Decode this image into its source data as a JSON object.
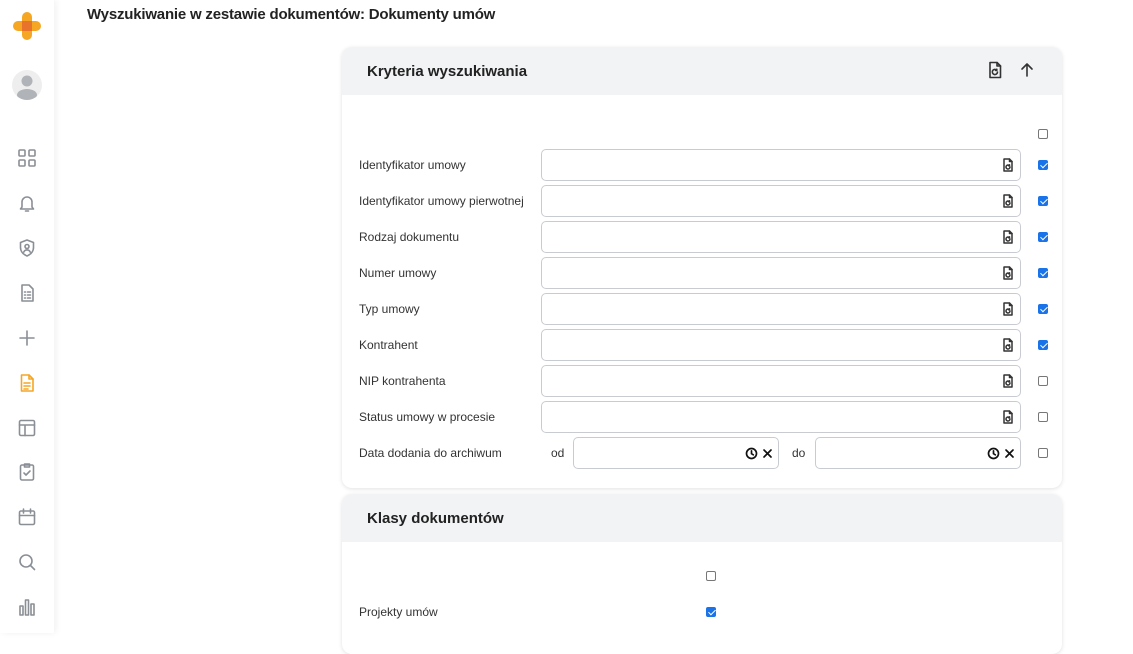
{
  "app": {
    "logo_icon": "plus-logo-icon",
    "accent_color": "#f5a623"
  },
  "sidebar": {
    "items": [
      {
        "name": "dashboard-icon",
        "active": false
      },
      {
        "name": "bell-icon",
        "active": false
      },
      {
        "name": "shield-icon",
        "active": false
      },
      {
        "name": "checklist-document-icon",
        "active": false
      },
      {
        "name": "plus-icon",
        "active": false
      },
      {
        "name": "document-icon",
        "active": true
      },
      {
        "name": "layout-icon",
        "active": false
      },
      {
        "name": "clipboard-check-icon",
        "active": false
      },
      {
        "name": "calendar-icon",
        "active": false
      },
      {
        "name": "search-icon",
        "active": false
      },
      {
        "name": "bar-chart-icon",
        "active": false
      }
    ]
  },
  "page": {
    "title": "Wyszukiwanie w zestawie dokumentów: Dokumenty umów"
  },
  "criteria": {
    "title": "Kryteria wyszukiwania",
    "select_all_checked": false,
    "fields": [
      {
        "label": "Identyfikator umowy",
        "value": "",
        "checked": true
      },
      {
        "label": "Identyfikator umowy pierwotnej",
        "value": "",
        "checked": true
      },
      {
        "label": "Rodzaj dokumentu",
        "value": "",
        "checked": true
      },
      {
        "label": "Numer umowy",
        "value": "",
        "checked": true
      },
      {
        "label": "Typ umowy",
        "value": "",
        "checked": true
      },
      {
        "label": "Kontrahent",
        "value": "",
        "checked": true
      },
      {
        "label": "NIP kontrahenta",
        "value": "",
        "checked": false
      },
      {
        "label": "Status umowy w procesie",
        "value": "",
        "checked": false
      }
    ],
    "date_field": {
      "label": "Data dodania do archiwum",
      "from_label": "od",
      "to_label": "do",
      "from_value": "",
      "to_value": "",
      "checked": false
    }
  },
  "classes": {
    "title": "Klasy dokumentów",
    "select_all_checked": false,
    "items": [
      {
        "label": "Projekty umów",
        "checked": true
      }
    ]
  }
}
